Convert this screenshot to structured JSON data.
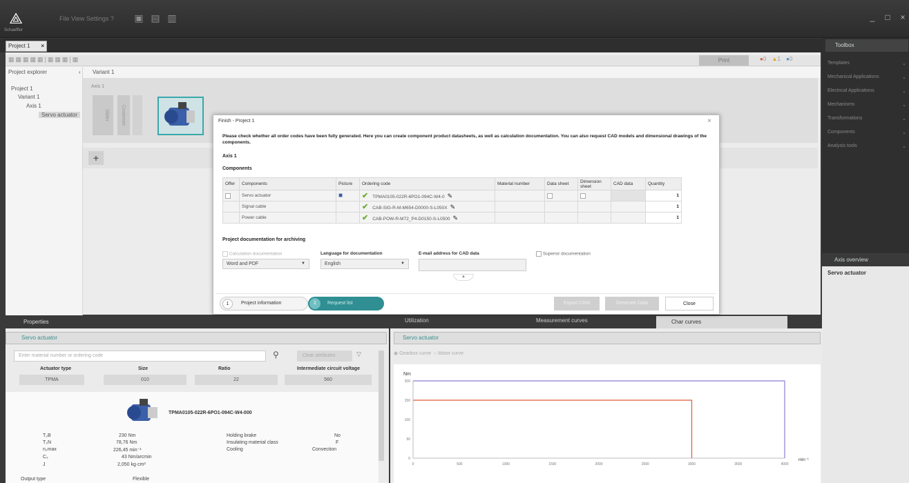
{
  "app": {
    "logo_text": "Schaeffler",
    "menu": "File  View  Settings  ?",
    "window_controls": [
      "_",
      "□",
      "×"
    ]
  },
  "project_tab": {
    "label": "Project 1",
    "close": "×"
  },
  "toolbar": {
    "print": "Print",
    "counts": [
      "0",
      "1",
      "0"
    ]
  },
  "explorer": {
    "title": "Project explorer",
    "collapse": "‹",
    "items": [
      "Project 1",
      "Variant 1",
      "Axis 1",
      "Servo actuator"
    ]
  },
  "variant_bar": "Variant 1",
  "axis": {
    "label": "Axis 1",
    "blocks": [
      "Slider",
      "Customer"
    ]
  },
  "toolbox": {
    "title": "Toolbox",
    "items": [
      "Templates",
      "Mechanical Applications",
      "Electrical Applications",
      "Mechanisms",
      "Transformations",
      "Components",
      "Analysis tools"
    ]
  },
  "axis_overview": {
    "title": "Axis overview",
    "item": "Servo actuator"
  },
  "dialog": {
    "title": "Finish - Project 1",
    "close": "×",
    "message": "Please check whether all order codes have been fully generated. Here you can create component product datasheets, as well as calculation documentation. You can also request CAD models and dimensional drawings of the components.",
    "axis": "Axis 1",
    "components_heading": "Components",
    "columns": [
      "Offer",
      "Components",
      "Picture",
      "Ordering code",
      "Material number",
      "Data sheet",
      "Dimension sheet",
      "CAD data",
      "Quantity"
    ],
    "rows": [
      {
        "component": "Servo actuator",
        "code": "TPMA0105-022R-6PO1-094C-W4-0",
        "qty": "1"
      },
      {
        "component": "Signal cable",
        "code": "CAB-SIG-R-M-M654-D0000-S-L050X",
        "qty": "1"
      },
      {
        "component": "Power cable",
        "code": "CAB-POW-R-M72_P4-D0150-S-L0500",
        "qty": "1"
      }
    ],
    "doc_heading": "Project documentation for archiving",
    "calc_doc": "Calculation documentation",
    "calc_format": "Word and PDF",
    "language_label": "Language for documentation",
    "language": "English",
    "email_label": "E-mail address for CAD data",
    "email_value": "",
    "superior_doc": "Superior documentation",
    "collapse": "▲",
    "step1": {
      "num": "1",
      "label": "Project information"
    },
    "step2": {
      "num": "2",
      "label": "Request list"
    },
    "export_btn": "Export CRM",
    "generate_btn": "Generate Data",
    "close_btn": "Close"
  },
  "properties": {
    "title": "Properties",
    "selected": "Servo actuator",
    "search_placeholder": "Enter material number or ordering code",
    "clear_filter": "Clear attributes",
    "fields": [
      {
        "label": "Actuator type",
        "value": "TPMA"
      },
      {
        "label": "Size",
        "value": "010"
      },
      {
        "label": "Ratio",
        "value": "22"
      },
      {
        "label": "Intermediate circuit voltage",
        "value": "560"
      }
    ],
    "product_code": "TPMA0105-022R-6PO1-094C-W4-000",
    "specs_left": [
      {
        "k": "T₂B",
        "v": "230 Nm"
      },
      {
        "k": "T₂N",
        "v": "78,76 Nm"
      },
      {
        "k": "n₂max",
        "v": "226,45 min⁻¹"
      },
      {
        "k": "C₂",
        "v": "43 Nm/arcmin"
      },
      {
        "k": "J",
        "v": "2,050 kg·cm²"
      }
    ],
    "specs_right": [
      {
        "k": "Holding brake",
        "v": "No"
      },
      {
        "k": "Insulating material class",
        "v": "F"
      },
      {
        "k": "Cooling",
        "v": "Convection"
      }
    ],
    "footer": [
      {
        "k": "Output type",
        "v": "Flexible"
      }
    ]
  },
  "chart_panel": {
    "tabs": [
      "Utilization",
      "Measurement curves",
      "Char curves"
    ],
    "selected": "Servo actuator",
    "radio": [
      "Gearbox curve",
      "Motor curve"
    ]
  },
  "chart_data": {
    "type": "line",
    "ylabel": "Nm",
    "xlabel": "min⁻¹",
    "xlim": [
      0,
      4000
    ],
    "ylim": [
      0,
      200
    ],
    "yticks": [
      "0",
      "50",
      "100",
      "150",
      "200"
    ],
    "xticks": [
      "0",
      "250",
      "500",
      "750",
      "1000",
      "1250",
      "1500",
      "1750",
      "2000",
      "2250",
      "2500",
      "2750",
      "3000",
      "3250",
      "3500",
      "3750",
      "4000"
    ],
    "series": [
      {
        "color": "#8a7fd6",
        "x": [
          0,
          4000,
          4000
        ],
        "y": [
          200,
          200,
          0
        ]
      },
      {
        "color": "#e05a3a",
        "x": [
          0,
          3000,
          3000
        ],
        "y": [
          150,
          150,
          0
        ]
      }
    ]
  }
}
